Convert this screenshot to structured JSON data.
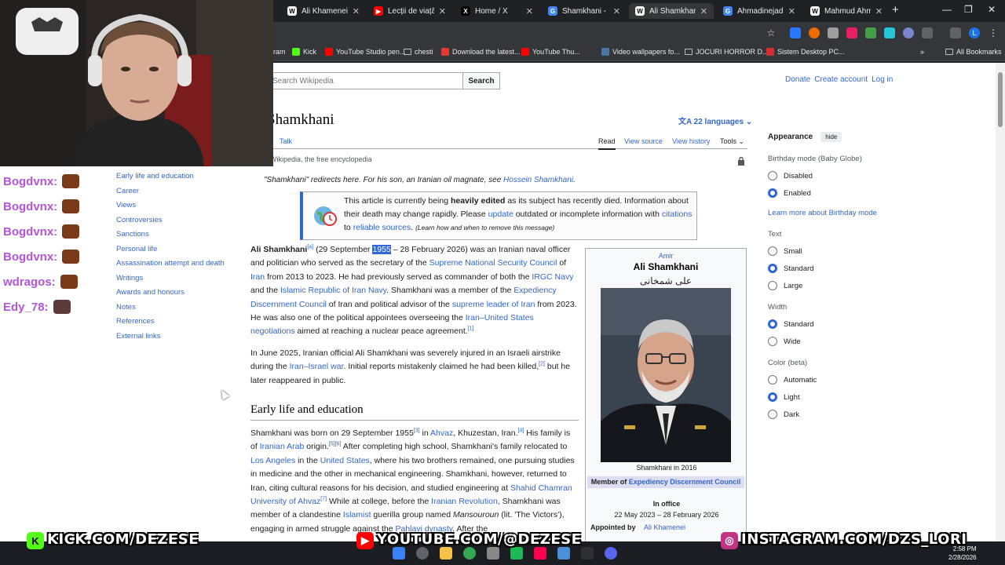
{
  "browser": {
    "tabs": [
      {
        "title": "Ali Khamenei - W",
        "icon": "wikipedia-icon",
        "color": "#ffffff"
      },
      {
        "title": "Lecții de viață - S",
        "icon": "youtube-icon",
        "color": "#ff0000"
      },
      {
        "title": "Home / X",
        "icon": "x-icon",
        "color": "#000000"
      },
      {
        "title": "Shamkhani - Cău",
        "icon": "google-icon",
        "color": "#4285f4"
      },
      {
        "title": "Ali Shamkhani - W",
        "icon": "wikipedia-icon",
        "color": "#ffffff",
        "active": true
      },
      {
        "title": "Ahmadinejad - Că",
        "icon": "google-icon",
        "color": "#4285f4"
      },
      {
        "title": "Mahmud Ahmadi",
        "icon": "wikipedia-icon",
        "color": "#ffffff"
      }
    ],
    "new_tab": "+",
    "bookmarks": [
      {
        "label": "ram",
        "icon": "bookmark-icon"
      },
      {
        "label": "Kick",
        "icon": "kick-icon",
        "color": "#53fc18"
      },
      {
        "label": "YouTube Studio pen...",
        "icon": "youtube-studio-icon",
        "color": "#ff0000"
      },
      {
        "label": "chesti",
        "icon": "folder-icon"
      },
      {
        "label": "Download the latest...",
        "icon": "download-icon",
        "color": "#e53935"
      },
      {
        "label": "YouTube Thu...",
        "icon": "youtube-icon",
        "color": "#ff0000"
      },
      {
        "label": "Video wallpapers fo...",
        "icon": "vk-icon",
        "color": "#4a76a8"
      },
      {
        "label": "JOCURI HORROR D...",
        "icon": "folder-icon"
      },
      {
        "label": "Sistem Desktop PC...",
        "icon": "pc-icon",
        "color": "#d32f2f"
      }
    ],
    "all_bookmarks": "All Bookmarks",
    "more": "»"
  },
  "wiki": {
    "search_placeholder": "Search Wikipedia",
    "search_button": "Search",
    "donate": "Donate",
    "create_account": "Create account",
    "login": "Log in",
    "title": "Shamkhani",
    "languages": "22 languages",
    "talk": "Talk",
    "read": "Read",
    "view_source": "View source",
    "view_history": "View history",
    "tools": "Tools",
    "tagline": "Wikipedia, the free encyclopedia",
    "hatnote_prefix": "\"Shamkhani\" redirects here. For his son, an Iranian oil magnate, see ",
    "hatnote_link": "Hossein Shamkhani",
    "hatnote_end": ".",
    "ambox": {
      "t1": "This article is currently being ",
      "t2": "heavily edited",
      "t3": " as its subject has recently died. Information about their death may change rapidly. Please ",
      "l1": "update",
      "t4": " outdated or incomplete information with ",
      "l2": "citations",
      "t5": " to ",
      "l3": "reliable sources",
      "t6": ". ",
      "small": "(Learn how and when to remove this message)"
    },
    "toc": [
      "Early life and education",
      "Career",
      "Views",
      "Controversies",
      "Sanctions",
      "Personal life",
      "Assassination attempt and death",
      "Writings",
      "Awards and honours",
      "Notes",
      "References",
      "External links"
    ],
    "lead": {
      "name": "Ali Shamkhani",
      "ref_a": "[a]",
      "t1": " (29 September ",
      "year": "1955",
      "t2": " – 28 February 2026) was an Iranian naval officer and politician who served as the secretary of the ",
      "l1": "Supreme National Security Council",
      "t3": " of ",
      "l2": "Iran",
      "t4": " from 2013 to 2023. He had previously served as commander of both the ",
      "l3": "IRGC Navy",
      "t5": " and the ",
      "l4": "Islamic Republic of Iran Navy",
      "t6": ". Shamkhani was a member of the ",
      "l5": "Expediency Discernment Council",
      "t7": " of Iran and political advisor of the ",
      "l6": "supreme leader of Iran",
      "t8": " from 2023. He was also one of the political appointees overseeing the ",
      "l7": "Iran–United States negotiations",
      "t9": " aimed at reaching a nuclear peace agreement.",
      "ref1": "[1]"
    },
    "para2": {
      "t1": "In June 2025, Iranian official Ali Shamkhani was severely injured in an Israeli airstrike during the ",
      "l1": "Iran–Israel war",
      "t2": ". Initial reports mistakenly claimed he had been killed,",
      "ref": "[2]",
      "t3": " but he later reappeared in public."
    },
    "h2": "Early life and education",
    "para3": {
      "t1": "Shamkhani was born on 29 September 1955",
      "r3": "[3]",
      "t2": " in ",
      "l1": "Ahvaz",
      "t3": ", Khuzestan, Iran.",
      "r4": "[4]",
      "t4": " His family is of ",
      "l2": "Iranian Arab",
      "t5": " origin.",
      "r56": "[5][6]",
      "t6": " After completing high school, Shamkhani's family relocated to ",
      "l3": "Los Angeles",
      "t7": " in the ",
      "l4": "United States",
      "t8": ", where his two brothers remained, one pursuing studies in medicine and the other in mechanical engineering. Shamkhani, however, returned to Iran, citing cultural reasons for his decision, and studied engineering at ",
      "l5": "Shahid Chamran University of Ahvaz",
      "r7": "[7]",
      "t9": " While at college, before the ",
      "l6": "Iranian Revolution",
      "t10": ", Shamkhani was member of a clandestine ",
      "l7": "Islamist",
      "t11": " guerilla group named ",
      "i1": "Mansouroun",
      "t12": " (lit. 'The Victors'), engaging in armed struggle against the ",
      "l8": "Pahlavi dynasty",
      "t13": ". After the"
    },
    "infobox": {
      "rank": "Amir",
      "name": "Ali Shamkhani",
      "native": "علی شمخانی",
      "caption": "Shamkhani in 2016",
      "member_of": "Member of ",
      "member_link": "Expediency Discernment Council",
      "in_office": "In office",
      "dates": "22 May 2023 – 28 February 2026",
      "appointed_by": "Appointed by",
      "appointer": "Ali Khamenei"
    },
    "appearance": {
      "title": "Appearance",
      "hide": "hide",
      "birthday_title": "Birthday mode (Baby Globe)",
      "birthday_opts": [
        {
          "label": "Disabled",
          "on": false
        },
        {
          "label": "Enabled",
          "on": true
        }
      ],
      "learn_more": "Learn more about Birthday mode",
      "text_title": "Text",
      "text_opts": [
        {
          "label": "Small",
          "on": false
        },
        {
          "label": "Standard",
          "on": true
        },
        {
          "label": "Large",
          "on": false
        }
      ],
      "width_title": "Width",
      "width_opts": [
        {
          "label": "Standard",
          "on": true
        },
        {
          "label": "Wide",
          "on": false
        }
      ],
      "color_title": "Color (beta)",
      "color_opts": [
        {
          "label": "Automatic",
          "on": false
        },
        {
          "label": "Light",
          "on": true
        },
        {
          "label": "Dark",
          "on": false
        }
      ]
    }
  },
  "stream": {
    "chat": [
      {
        "user": "Bogdvnx:"
      },
      {
        "user": "Bogdvnx:"
      },
      {
        "user": "Bogdvnx:"
      },
      {
        "user": "Bogdvnx:"
      },
      {
        "user": "wdragos:"
      },
      {
        "user": "Edy_78:"
      }
    ],
    "banner": {
      "kick": "KICK.COM/DEZESE",
      "youtube": "YOUTUBE.COM/@DEZESE",
      "instagram": "INSTAGRAM.COM/DZS_LORI"
    },
    "colors": {
      "chat_name": "#b355d6",
      "kick": "#53fc18",
      "youtube": "#ff0000",
      "instagram": "#c13584"
    }
  },
  "taskbar": {
    "time": "2:58 PM",
    "date": "2/28/2026"
  }
}
